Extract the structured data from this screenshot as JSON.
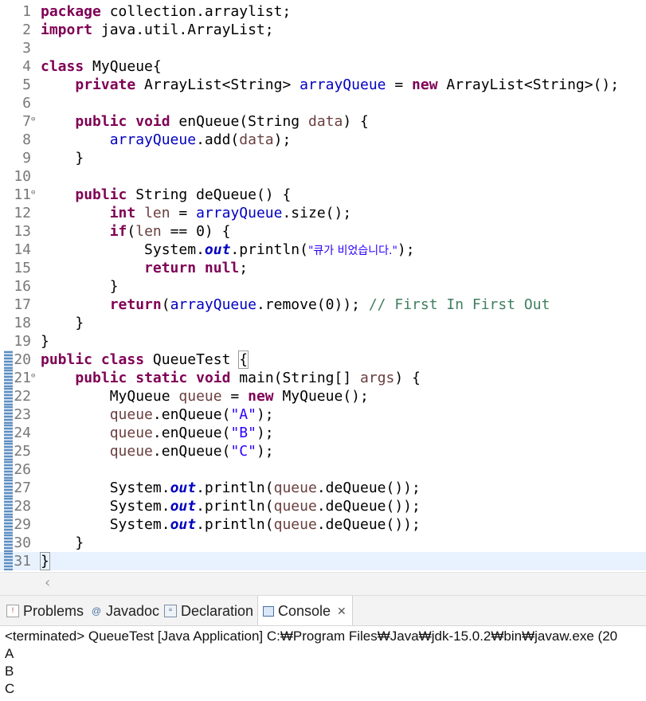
{
  "editor": {
    "lines": [
      {
        "n": "1"
      },
      {
        "n": "2"
      },
      {
        "n": "3"
      },
      {
        "n": "4"
      },
      {
        "n": "5"
      },
      {
        "n": "6"
      },
      {
        "n": "7"
      },
      {
        "n": "8"
      },
      {
        "n": "9"
      },
      {
        "n": "10"
      },
      {
        "n": "11"
      },
      {
        "n": "12"
      },
      {
        "n": "13"
      },
      {
        "n": "14"
      },
      {
        "n": "15"
      },
      {
        "n": "16"
      },
      {
        "n": "17"
      },
      {
        "n": "18"
      },
      {
        "n": "19"
      },
      {
        "n": "20"
      },
      {
        "n": "21"
      },
      {
        "n": "22"
      },
      {
        "n": "23"
      },
      {
        "n": "24"
      },
      {
        "n": "25"
      },
      {
        "n": "26"
      },
      {
        "n": "27"
      },
      {
        "n": "28"
      },
      {
        "n": "29"
      },
      {
        "n": "30"
      },
      {
        "n": "31"
      }
    ],
    "code": {
      "package": "package",
      "pkg_name": " collection.arraylist;",
      "import": "import",
      "import_name": " java.util.ArrayList;",
      "class": "class",
      "myqueue_decl": " MyQueue{",
      "private": "private",
      "arraylist_string": " ArrayList<String> ",
      "arrayQueue": "arrayQueue",
      "eq": " = ",
      "new": "new",
      "arraylist_ctor": " ArrayList<String>();",
      "public": "public",
      "void": "void",
      "enqueue_sig_a": " enQueue(String ",
      "data": "data",
      "sig_close": ") {",
      "add_call": ".add(",
      "close_stmt": ");",
      "brace_close": "}",
      "string_type": " String ",
      "dequeue_sig": "deQueue() {",
      "int": "int",
      "len": "len",
      "size_call": ".size();",
      "if": "if",
      "paren_open": "(",
      "eq_zero": " == 0) {",
      "system": "System.",
      "out": "out",
      "println_open": ".println(",
      "empty_msg": "\"큐가 비었습니다.\"",
      "return": "return",
      "null": "null",
      "semicolon": ";",
      "remove_call": ".remove(0)); ",
      "comment": "// First In First Out",
      "queuetest_name": " QueueTest ",
      "open_brace": "{",
      "static": "static",
      "main_sig_a": " main(String[] ",
      "args": "args",
      "myqueue_type": "MyQueue ",
      "queue": "queue",
      "myqueue_ctor": " MyQueue();",
      "enqueue_call": ".enQueue(",
      "str_a": "\"A\"",
      "str_b": "\"B\"",
      "str_c": "\"C\"",
      "dequeue_call": ".deQueue());"
    }
  },
  "tabs": {
    "problems": "Problems",
    "javadoc": "Javadoc",
    "declaration": "Declaration",
    "console": "Console",
    "close": "✕"
  },
  "console": {
    "terminated": "<terminated> QueueTest [Java Application] C:₩Program Files₩Java₩jdk-15.0.2₩bin₩javaw.exe  (20",
    "output": [
      "A",
      "B",
      "C"
    ]
  }
}
